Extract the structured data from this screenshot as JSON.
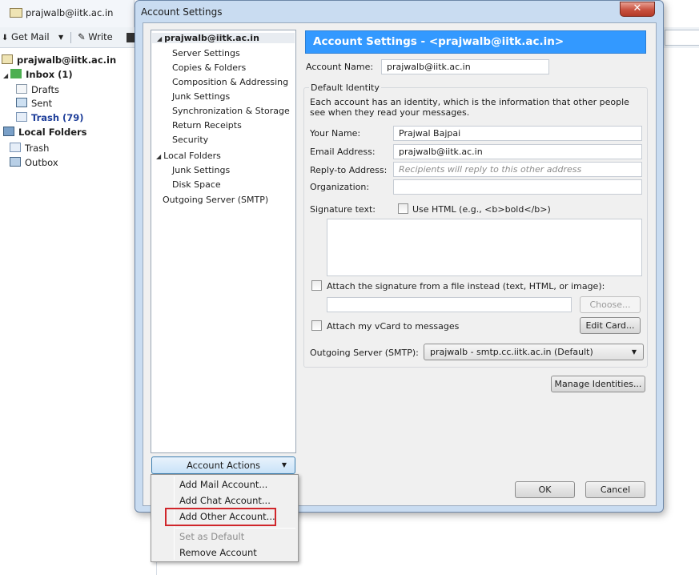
{
  "background": {
    "tab_title": "prajwalb@iitk.ac.in",
    "toolbar": {
      "get_mail": "Get Mail",
      "write": "Write"
    },
    "folders": {
      "account": "prajwalb@iitk.ac.in",
      "inbox": "Inbox (1)",
      "drafts": "Drafts",
      "sent": "Sent",
      "trash": "Trash (79)",
      "local_folders": "Local Folders",
      "local_trash": "Trash",
      "outbox": "Outbox"
    }
  },
  "dialog": {
    "title": "Account Settings",
    "close": "✕",
    "tree": [
      {
        "label": "prajwalb@iitk.ac.in",
        "selected": true
      },
      {
        "label": "Server Settings"
      },
      {
        "label": "Copies & Folders"
      },
      {
        "label": "Composition & Addressing"
      },
      {
        "label": "Junk Settings"
      },
      {
        "label": "Synchronization & Storage"
      },
      {
        "label": "Security"
      },
      {
        "label": "Return Receipts"
      },
      {
        "label": "Local Folders"
      },
      {
        "label": "Junk Settings"
      },
      {
        "label": "Disk Space"
      },
      {
        "label": "Outgoing Server (SMTP)"
      }
    ],
    "account_actions": "Account Actions",
    "banner": "Account Settings - <prajwalb@iitk.ac.in>",
    "account_name_label": "Account Name:",
    "account_name_value": "prajwalb@iitk.ac.in",
    "default_identity_legend": "Default Identity",
    "identity_description": "Each account has an identity, which is the information that other people see when they read your messages.",
    "your_name_label": "Your Name:",
    "your_name_value": "Prajwal Bajpai",
    "email_label": "Email Address:",
    "email_value": "prajwalb@iitk.ac.in",
    "reply_to_label": "Reply-to Address:",
    "reply_to_placeholder": "Recipients will reply to this other address",
    "organization_label": "Organization:",
    "organization_value": "",
    "signature_label": "Signature text:",
    "use_html_label": "Use HTML (e.g., <b>bold</b>)",
    "attach_signature_label": "Attach the signature from a file instead (text, HTML, or image):",
    "choose_button": "Choose...",
    "attach_vcard_label": "Attach my vCard to messages",
    "edit_card_button": "Edit Card...",
    "smtp_label": "Outgoing Server (SMTP):",
    "smtp_value": "prajwalb - smtp.cc.iitk.ac.in (Default)",
    "manage_identities_button": "Manage Identities...",
    "ok_button": "OK",
    "cancel_button": "Cancel"
  },
  "menu": {
    "add_mail": "Add Mail Account...",
    "add_chat": "Add Chat Account...",
    "add_other": "Add Other Account...",
    "set_default": "Set as Default",
    "remove": "Remove Account"
  },
  "colors": {
    "banner": "#3399ff",
    "highlight_box": "#d0262b",
    "dialog_frame": "#c9dcf1"
  }
}
